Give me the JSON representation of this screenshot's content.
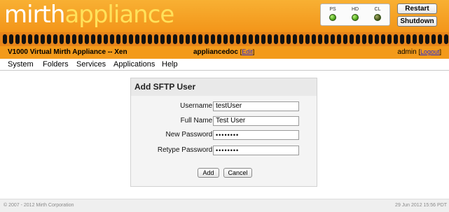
{
  "header": {
    "logo_word1": "mirth",
    "logo_word2": "appliance",
    "lights": [
      {
        "label": "PS",
        "state": "on"
      },
      {
        "label": "HD",
        "state": "on"
      },
      {
        "label": "CL",
        "state": "dim"
      }
    ],
    "restart_label": "Restart",
    "shutdown_label": "Shutdown",
    "appliance_name": "V1000 Virtual Mirth Appliance -- Xen",
    "hostname": "appliancedoc",
    "edit_label": "Edit",
    "user": "admin",
    "logout_label": "Logout"
  },
  "menu": {
    "items": [
      "System",
      "Folders",
      "Services",
      "Applications",
      "Help"
    ]
  },
  "form": {
    "title": "Add SFTP User",
    "username_label": "Username:",
    "username_value": "testUser",
    "fullname_label": "Full Name:",
    "fullname_value": "Test User",
    "newpw_label": "New Password:",
    "newpw_value": "••••••••",
    "retype_label": "Retype Password:",
    "retype_value": "••••••••",
    "add_label": "Add",
    "cancel_label": "Cancel"
  },
  "footer": {
    "copyright": "© 2007 - 2012 Mirth Corporation",
    "timestamp": "29 Jun 2012 15:56 PDT"
  },
  "colors": {
    "header_orange": "#f39a1a",
    "logo_yellow": "#ffe15a",
    "light_green": "#4da51c"
  }
}
